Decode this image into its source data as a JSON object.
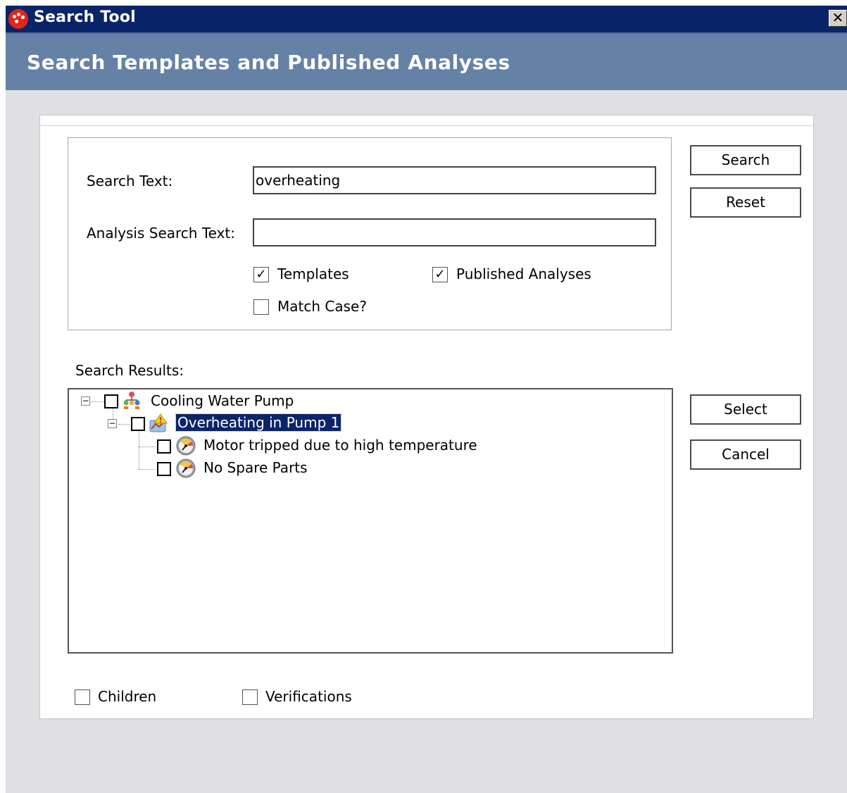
{
  "window": {
    "title": "Search Tool",
    "close_glyph": "✕"
  },
  "banner": {
    "heading": "Search Templates and Published Analyses"
  },
  "criteria": {
    "search_text_label": "Search Text:",
    "search_text_value": "overheating",
    "analysis_search_label": "Analysis Search Text:",
    "analysis_search_value": "",
    "templates_label": "Templates",
    "templates_checked": true,
    "published_label": "Published Analyses",
    "published_checked": true,
    "match_case_label": "Match Case?",
    "match_case_checked": false
  },
  "buttons": {
    "search": "Search",
    "reset": "Reset",
    "select": "Select",
    "cancel": "Cancel"
  },
  "results": {
    "label": "Search Results:",
    "tree": [
      {
        "label": "Cooling Water Pump",
        "icon": "hierarchy-icon",
        "expanded": true,
        "selected": false
      },
      {
        "label": "Overheating in Pump 1",
        "icon": "warning-analysis-icon",
        "expanded": true,
        "selected": true
      },
      {
        "label": "Motor tripped due to high temperature",
        "icon": "gauge-icon",
        "selected": false
      },
      {
        "label": "No Spare Parts",
        "icon": "gauge-icon",
        "selected": false
      }
    ]
  },
  "options": {
    "children_label": "Children",
    "children_checked": false,
    "verifications_label": "Verifications",
    "verifications_checked": false
  },
  "colors": {
    "titlebar": "#0a246a",
    "banner": "#6582a6",
    "window_bg": "#e0dfe3",
    "selection": "#0a246a"
  }
}
